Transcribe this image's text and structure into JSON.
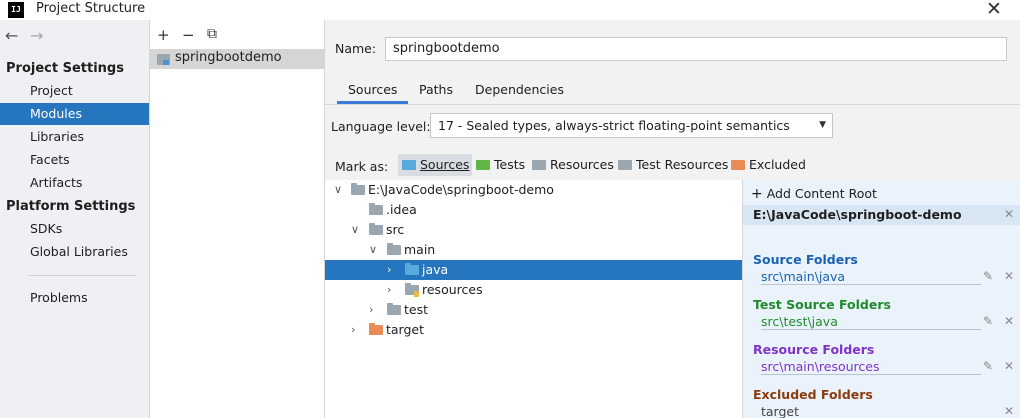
{
  "window": {
    "title": "Project Structure",
    "app_icon": "intellij-icon"
  },
  "nav": {
    "back_icon": "←",
    "forward_icon": "→",
    "project_settings_header": "Project Settings",
    "project_settings": [
      "Project",
      "Modules",
      "Libraries",
      "Facets",
      "Artifacts"
    ],
    "platform_settings_header": "Platform Settings",
    "platform_settings": [
      "SDKs",
      "Global Libraries"
    ],
    "problems": "Problems",
    "selected": "Modules"
  },
  "module_list": {
    "add_icon": "+",
    "remove_icon": "−",
    "copy_icon": "⧉",
    "modules": [
      "springbootdemo"
    ]
  },
  "module": {
    "name_label": "Name:",
    "name_value": "springbootdemo",
    "tabs": [
      "Sources",
      "Paths",
      "Dependencies"
    ],
    "active_tab": "Sources",
    "language_level_label": "Language level:",
    "language_level_value": "17 - Sealed types, always-strict floating-point semantics",
    "mark_as_label": "Mark as:",
    "mark_as_buttons": [
      "Sources",
      "Tests",
      "Resources",
      "Test Resources",
      "Excluded"
    ]
  },
  "tree": [
    {
      "label": "E:\\JavaCode\\springboot-demo",
      "depth": 0,
      "expanded": true,
      "type": "folder"
    },
    {
      "label": ".idea",
      "depth": 1,
      "expanded": null,
      "type": "folder"
    },
    {
      "label": "src",
      "depth": 1,
      "expanded": true,
      "type": "folder"
    },
    {
      "label": "main",
      "depth": 2,
      "expanded": true,
      "type": "folder"
    },
    {
      "label": "java",
      "depth": 3,
      "expanded": false,
      "type": "source",
      "selected": true
    },
    {
      "label": "resources",
      "depth": 3,
      "expanded": false,
      "type": "resource"
    },
    {
      "label": "test",
      "depth": 2,
      "expanded": false,
      "type": "folder"
    },
    {
      "label": "target",
      "depth": 1,
      "expanded": false,
      "type": "excluded"
    }
  ],
  "content_root": {
    "add_label": "Add Content Root",
    "root_path": "E:\\JavaCode\\springboot-demo",
    "sections": [
      {
        "title": "Source Folders",
        "path": "src\\main\\java",
        "color": "#1a62b3",
        "editable": true
      },
      {
        "title": "Test Source Folders",
        "path": "src\\test\\java",
        "color": "#228a2a",
        "editable": true
      },
      {
        "title": "Resource Folders",
        "path": "src\\main\\resources",
        "color": "#8033c7",
        "editable": true
      },
      {
        "title": "Excluded Folders",
        "path": "target",
        "color": "#8b3c0f",
        "editable": false
      }
    ]
  },
  "colors": {
    "selection": "#2675bf",
    "folder_gray": "#9aa7b0",
    "folder_source": "#5aa9dd",
    "folder_test": "#62b543",
    "folder_resource": "#9aa7b0",
    "folder_excluded": "#e88b57"
  }
}
